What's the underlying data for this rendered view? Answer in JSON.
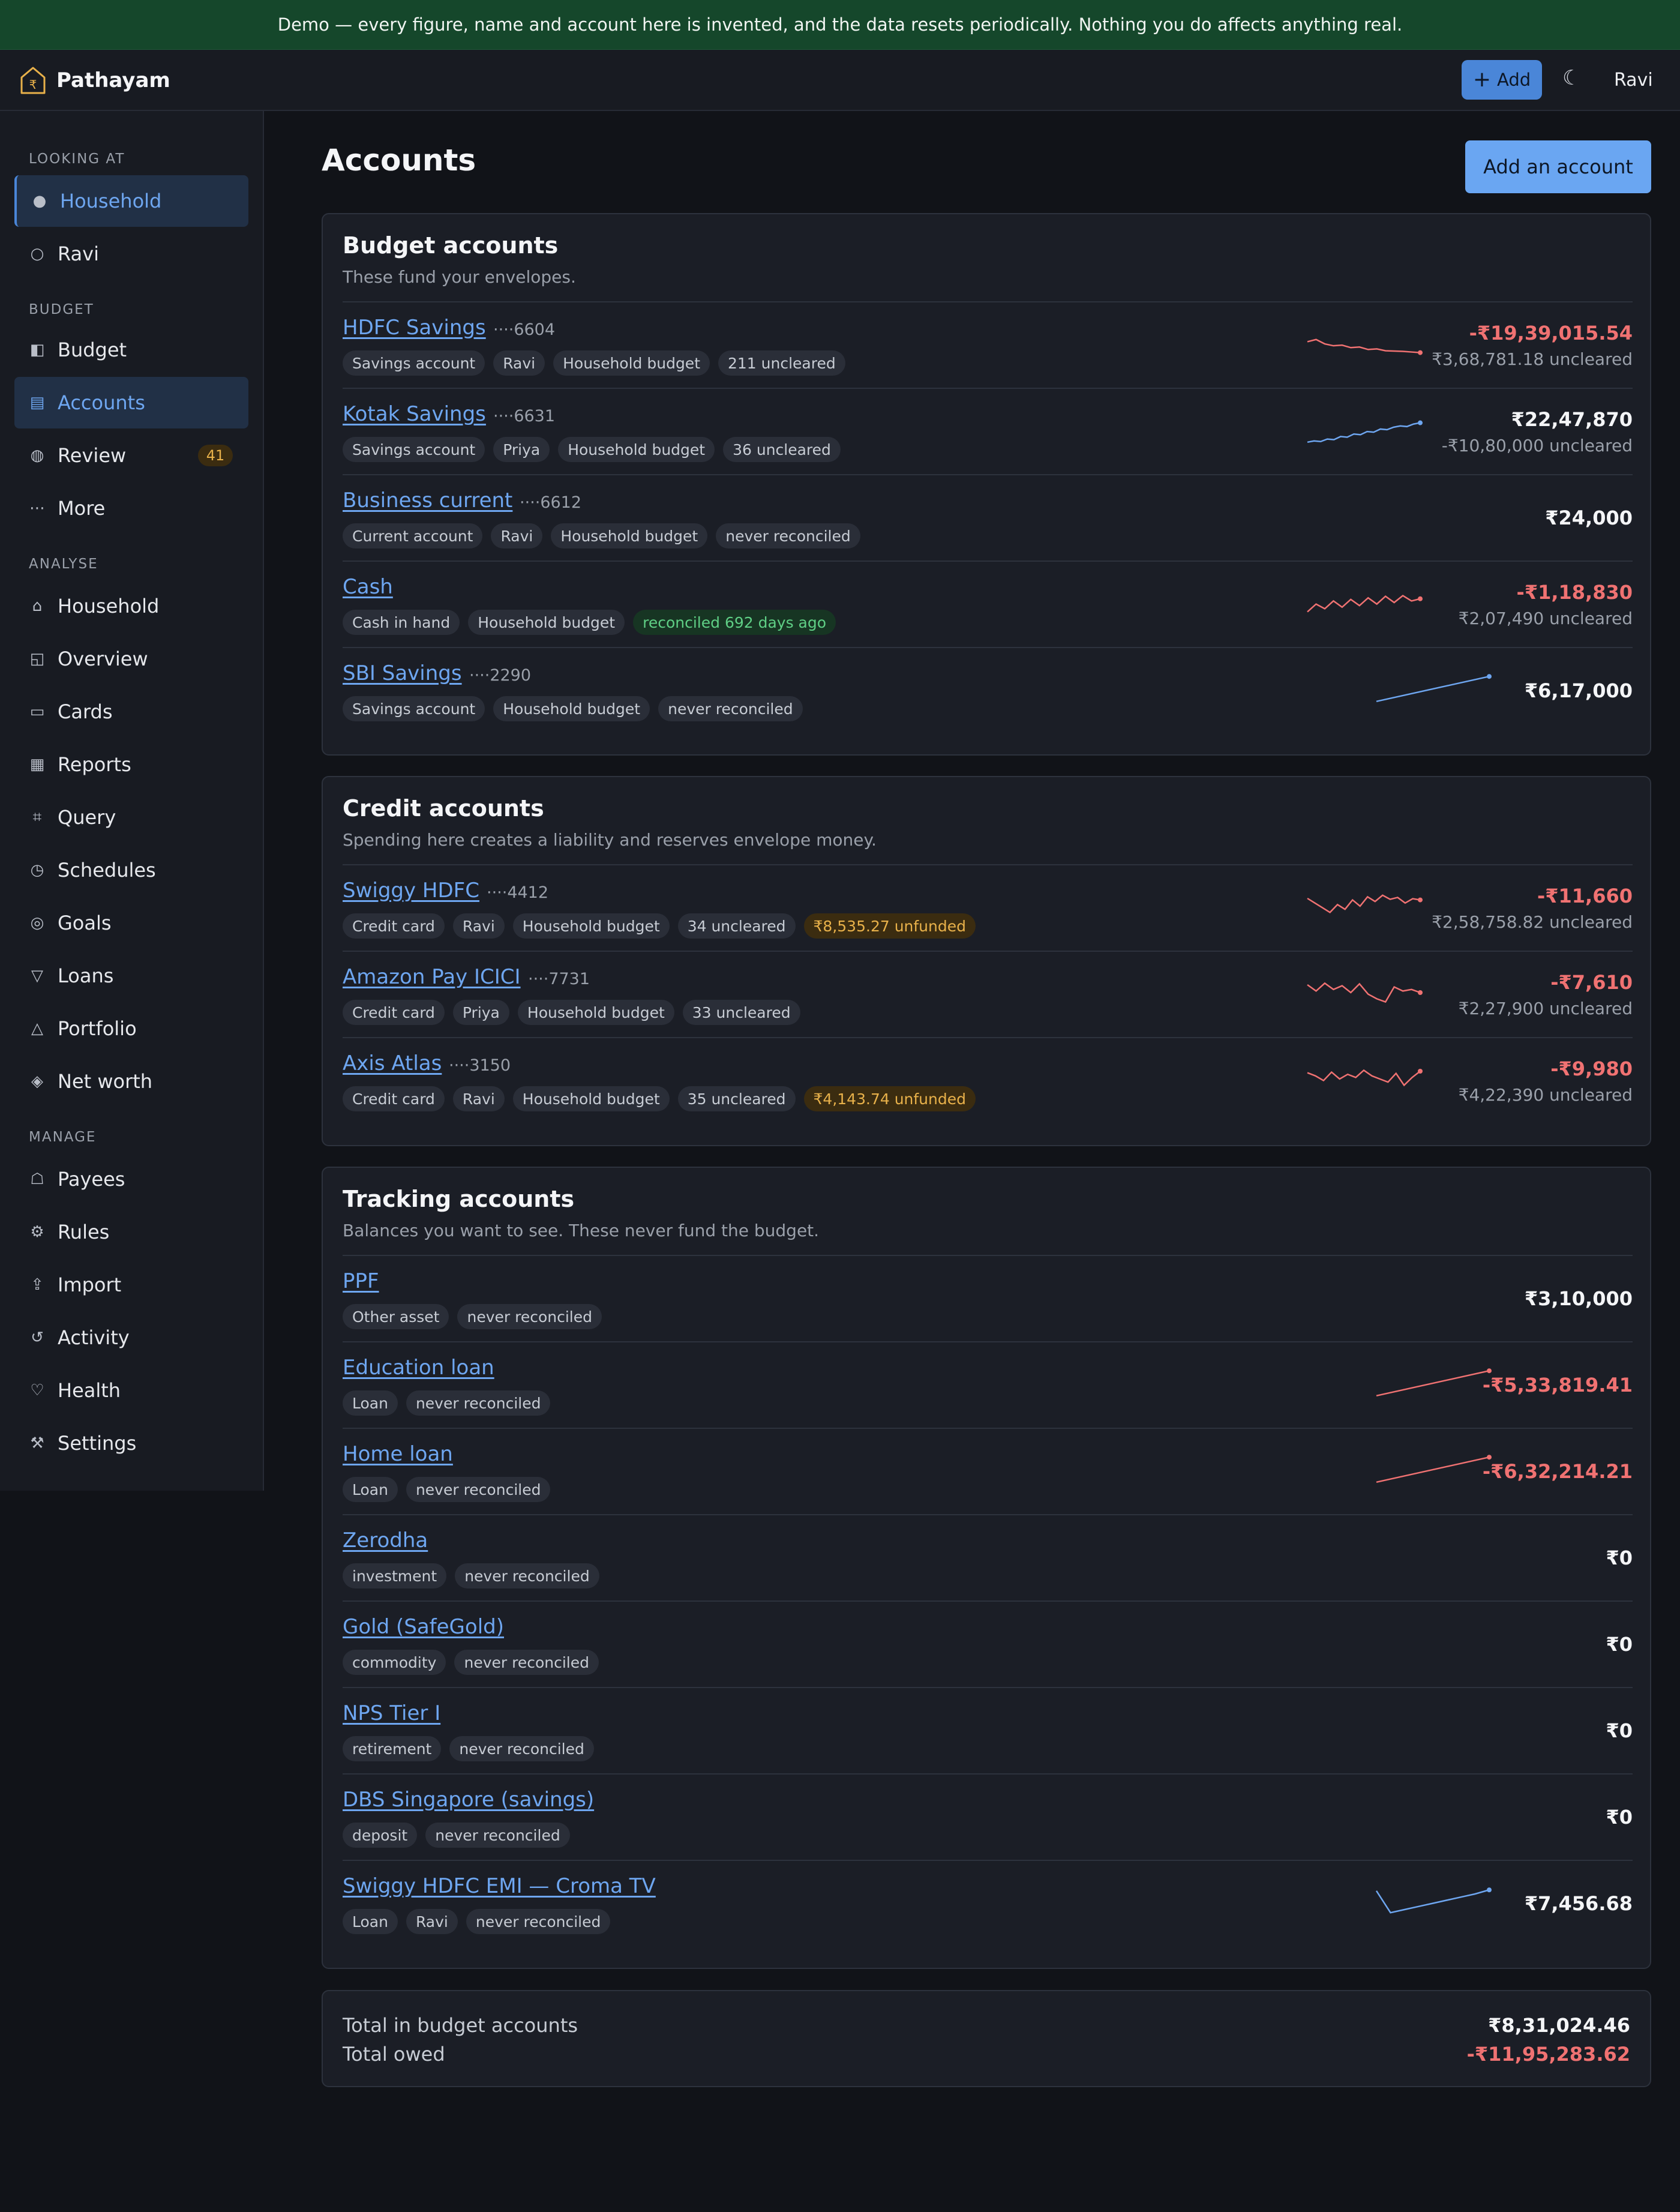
{
  "banner": {
    "text": "Demo — every figure, name and account here is invented, and the data resets periodically. Nothing you do affects anything real."
  },
  "topbar": {
    "brand": "Pathayam",
    "add_label": "Add",
    "theme_icon": "moon-icon",
    "user": "Ravi"
  },
  "sidebar": {
    "looking_at_label": "LOOKING AT",
    "looking_at": [
      {
        "label": "Household",
        "selected": true
      },
      {
        "label": "Ravi",
        "selected": false
      }
    ],
    "budget_label": "BUDGET",
    "budget": [
      {
        "label": "Budget",
        "icon": "budget-icon"
      },
      {
        "label": "Accounts",
        "icon": "accounts-icon",
        "active": true
      },
      {
        "label": "Review",
        "icon": "review-icon",
        "badge": "41"
      },
      {
        "label": "More",
        "icon": "more-icon"
      }
    ],
    "analyse_label": "ANALYSE",
    "analyse": [
      {
        "label": "Household",
        "icon": "home-icon"
      },
      {
        "label": "Overview",
        "icon": "overview-icon"
      },
      {
        "label": "Cards",
        "icon": "card-icon"
      },
      {
        "label": "Reports",
        "icon": "reports-icon"
      },
      {
        "label": "Query",
        "icon": "query-icon"
      },
      {
        "label": "Schedules",
        "icon": "clock-icon"
      },
      {
        "label": "Goals",
        "icon": "target-icon"
      },
      {
        "label": "Loans",
        "icon": "loan-icon"
      },
      {
        "label": "Portfolio",
        "icon": "portfolio-icon"
      },
      {
        "label": "Net worth",
        "icon": "diamond-icon"
      }
    ],
    "manage_label": "MANAGE",
    "manage": [
      {
        "label": "Payees",
        "icon": "payee-icon"
      },
      {
        "label": "Rules",
        "icon": "gear-icon"
      },
      {
        "label": "Import",
        "icon": "import-icon"
      },
      {
        "label": "Activity",
        "icon": "refresh-icon"
      },
      {
        "label": "Health",
        "icon": "heart-icon"
      },
      {
        "label": "Settings",
        "icon": "tools-icon"
      }
    ]
  },
  "main": {
    "title": "Accounts",
    "add_account_label": "Add an account",
    "budget_card": {
      "title": "Budget accounts",
      "subtitle": "These fund your envelopes.",
      "rows": [
        {
          "name": "HDFC Savings",
          "mask": "····6604",
          "tags": [
            "Savings account",
            "Ravi",
            "Household budget",
            "211 uncleared"
          ],
          "amount": "-₹19,39,015.54",
          "negative": true,
          "uncleared": "₹3,68,781.18 uncleared",
          "spark_color": "#f07272",
          "spark": [
            0.55,
            0.62,
            0.48,
            0.42,
            0.44,
            0.36,
            0.38,
            0.3,
            0.32,
            0.26,
            0.25,
            0.24,
            0.22,
            0.2
          ]
        },
        {
          "name": "Kotak Savings",
          "mask": "····6631",
          "tags": [
            "Savings account",
            "Priya",
            "Household budget",
            "36 uncleared"
          ],
          "amount": "₹22,47,870",
          "negative": false,
          "uncleared": "-₹10,80,000 uncleared",
          "spark_color": "#6ea6f0",
          "spark": [
            0.1,
            0.14,
            0.12,
            0.2,
            0.18,
            0.28,
            0.26,
            0.36,
            0.34,
            0.44,
            0.42,
            0.52,
            0.5,
            0.58,
            0.62,
            0.6,
            0.68,
            0.72
          ]
        },
        {
          "name": "Business current",
          "mask": "····6612",
          "tags": [
            "Current account",
            "Ravi",
            "Household budget",
            "never reconciled"
          ],
          "amount": "₹24,000",
          "negative": false,
          "uncleared": "",
          "spark_color": "",
          "spark": []
        },
        {
          "name": "Cash",
          "mask": "",
          "tags": [
            "Cash in hand",
            "Household budget",
            "reconciled 692 days ago"
          ],
          "amount": "-₹1,18,830",
          "negative": true,
          "uncleared": "₹2,07,490 uncleared",
          "spark_color": "#f07272",
          "spark": [
            0.2,
            0.45,
            0.3,
            0.55,
            0.35,
            0.6,
            0.4,
            0.65,
            0.45,
            0.7,
            0.5,
            0.72,
            0.55,
            0.62
          ]
        },
        {
          "name": "SBI Savings",
          "mask": "····2290",
          "tags": [
            "Savings account",
            "Household budget",
            "never reconciled"
          ],
          "amount": "₹6,17,000",
          "negative": false,
          "uncleared": "",
          "spark_color": "#6ea6f0",
          "spark": [
            0.1,
            0.9
          ]
        }
      ]
    },
    "credit_card": {
      "title": "Credit accounts",
      "subtitle": "Spending here creates a liability and reserves envelope money.",
      "rows": [
        {
          "name": "Swiggy HDFC",
          "mask": "····4412",
          "tags": [
            "Credit card",
            "Ravi",
            "Household budget",
            "34 uncleared",
            "₹8,535.27 unfunded"
          ],
          "amount": "-₹11,660",
          "negative": true,
          "uncleared": "₹2,58,758.82 uncleared",
          "spark_color": "#f07272",
          "spark": [
            0.75,
            0.6,
            0.45,
            0.3,
            0.55,
            0.4,
            0.7,
            0.5,
            0.8,
            0.65,
            0.85,
            0.72,
            0.78,
            0.6,
            0.74,
            0.7
          ]
        },
        {
          "name": "Amazon Pay ICICI",
          "mask": "····7731",
          "tags": [
            "Credit card",
            "Priya",
            "Household budget",
            "33 uncleared"
          ],
          "amount": "-₹7,610",
          "negative": true,
          "uncleared": "₹2,27,900 uncleared",
          "spark_color": "#f07272",
          "spark": [
            0.75,
            0.55,
            0.8,
            0.6,
            0.72,
            0.5,
            0.78,
            0.45,
            0.3,
            0.2,
            0.68,
            0.55,
            0.6,
            0.5
          ]
        },
        {
          "name": "Axis Atlas",
          "mask": "····3150",
          "tags": [
            "Credit card",
            "Ravi",
            "Household budget",
            "35 uncleared",
            "₹4,143.74 unfunded"
          ],
          "amount": "-₹9,980",
          "negative": true,
          "uncleared": "₹4,22,390 uncleared",
          "spark_color": "#f07272",
          "spark": [
            0.7,
            0.6,
            0.45,
            0.72,
            0.5,
            0.65,
            0.55,
            0.78,
            0.6,
            0.5,
            0.4,
            0.68,
            0.3,
            0.55,
            0.75
          ]
        }
      ]
    },
    "tracking_card": {
      "title": "Tracking accounts",
      "subtitle": "Balances you want to see. These never fund the budget.",
      "rows": [
        {
          "name": "PPF",
          "mask": "",
          "tags": [
            "Other asset",
            "never reconciled"
          ],
          "amount": "₹3,10,000",
          "negative": false,
          "uncleared": "",
          "spark_color": "",
          "spark": []
        },
        {
          "name": "Education loan",
          "mask": "",
          "tags": [
            "Loan",
            "never reconciled"
          ],
          "amount": "-₹5,33,819.41",
          "negative": true,
          "uncleared": "",
          "spark_color": "#f07272",
          "spark": [
            0.1,
            0.9
          ]
        },
        {
          "name": "Home loan",
          "mask": "",
          "tags": [
            "Loan",
            "never reconciled"
          ],
          "amount": "-₹6,32,214.21",
          "negative": true,
          "uncleared": "",
          "spark_color": "#f07272",
          "spark": [
            0.1,
            0.9
          ]
        },
        {
          "name": "Zerodha",
          "mask": "",
          "tags": [
            "investment",
            "never reconciled"
          ],
          "amount": "₹0",
          "negative": false,
          "uncleared": "",
          "spark_color": "",
          "spark": []
        },
        {
          "name": "Gold (SafeGold)",
          "mask": "",
          "tags": [
            "commodity",
            "never reconciled"
          ],
          "amount": "₹0",
          "negative": false,
          "uncleared": "",
          "spark_color": "",
          "spark": []
        },
        {
          "name": "NPS Tier I",
          "mask": "",
          "tags": [
            "retirement",
            "never reconciled"
          ],
          "amount": "₹0",
          "negative": false,
          "uncleared": "",
          "spark_color": "",
          "spark": []
        },
        {
          "name": "DBS Singapore (savings)",
          "mask": "",
          "tags": [
            "deposit",
            "never reconciled"
          ],
          "amount": "₹0",
          "negative": false,
          "uncleared": "",
          "spark_color": "",
          "spark": []
        },
        {
          "name": "Swiggy HDFC EMI — Croma TV",
          "mask": "",
          "tags": [
            "Loan",
            "Ravi",
            "never reconciled"
          ],
          "amount": "₹7,456.68",
          "negative": false,
          "uncleared": "",
          "spark_color": "#6ea6f0",
          "spark": [
            0.85,
            0.15,
            0.25,
            0.35,
            0.45,
            0.55,
            0.65,
            0.75,
            0.88
          ]
        }
      ]
    },
    "totals": {
      "budget_label": "Total in budget accounts",
      "budget_value": "₹8,31,024.46",
      "owed_label": "Total owed",
      "owed_value": "-₹11,95,283.62"
    }
  }
}
